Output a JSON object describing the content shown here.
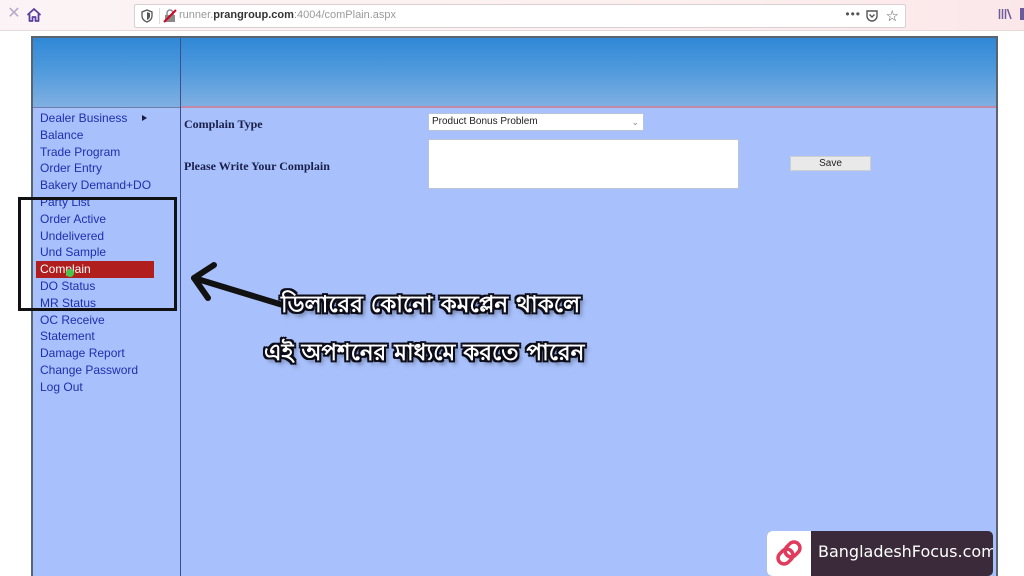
{
  "browser": {
    "url_prefix": "runner.",
    "url_domain": "prangroup.com",
    "url_suffix": ":4004/comPlain.aspx",
    "more_label": "•••"
  },
  "sidebar": {
    "items": [
      {
        "label": "Dealer Business",
        "has_submenu": true
      },
      {
        "label": "Balance"
      },
      {
        "label": "Trade Program"
      },
      {
        "label": "Order Entry"
      },
      {
        "label": "Bakery Demand+DO"
      },
      {
        "label": "Party List"
      },
      {
        "label": "Order Active"
      },
      {
        "label": "Undelivered"
      },
      {
        "label": "Und Sample"
      },
      {
        "label": "Complain",
        "active": true
      },
      {
        "label": "DO Status"
      },
      {
        "label": "MR Status"
      },
      {
        "label": "OC Receive"
      },
      {
        "label": "Statement"
      },
      {
        "label": "Damage Report"
      },
      {
        "label": "Change Password"
      },
      {
        "label": "Log Out"
      }
    ]
  },
  "form": {
    "complain_type_label": "Complain Type",
    "complain_type_value": "Product Bonus Problem",
    "write_label": "Please Write Your Complain",
    "complain_text": "",
    "save_label": "Save"
  },
  "annotation": {
    "line1": "ডিলারের কোনো কমপ্লেন থাকলে",
    "line2": "এই অপশনের মাধ্যমে করতে পারেন"
  },
  "watermark": {
    "text": "BangladeshFocus.com"
  },
  "colors": {
    "active_item": "#b01e1e",
    "menu_link": "#1f2fae",
    "page_bg": "#a8c0fb"
  }
}
